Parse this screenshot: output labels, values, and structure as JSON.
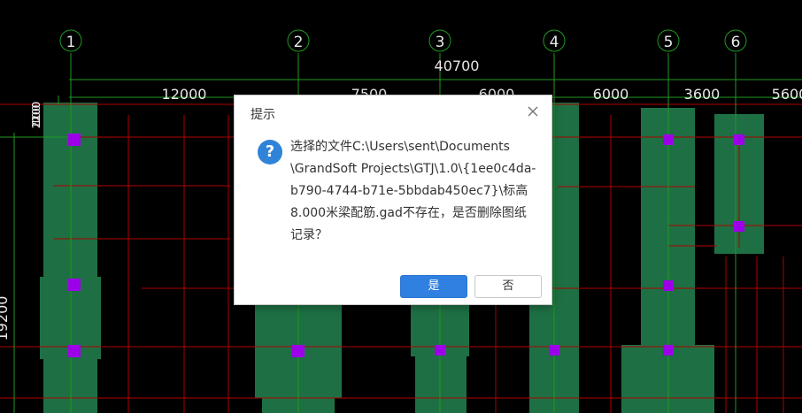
{
  "axes": [
    {
      "label": "1"
    },
    {
      "label": "2"
    },
    {
      "label": "3"
    },
    {
      "label": "4"
    },
    {
      "label": "5"
    },
    {
      "label": "6"
    }
  ],
  "dimensions": {
    "total": "40700",
    "spans": [
      "12000",
      "7500",
      "6000",
      "6000",
      "3600",
      "5600"
    ],
    "left_vertical": "19200",
    "left_stacked": [
      "1200",
      "100",
      "2100"
    ]
  },
  "dialog": {
    "title": "提示",
    "message": "选择的文件C:\\Users\\sent\\Documents\n\\GrandSoft Projects\\GTJ\\1.0\\{1ee0c4da-\nb790-4744-b71e-5bbdab450ec7}\\标高\n8.000米梁配筋.gad不存在，是否删除图纸\n记录？",
    "icon": "question-icon",
    "yes_label": "是",
    "no_label": "否"
  },
  "colors": {
    "background": "#000000",
    "axis_line": "#1f9a1f",
    "beam_fill": "#1e7044",
    "grid_line": "#b00000",
    "column_marker": "#9b00e8",
    "primary_button": "#2f80e0"
  }
}
